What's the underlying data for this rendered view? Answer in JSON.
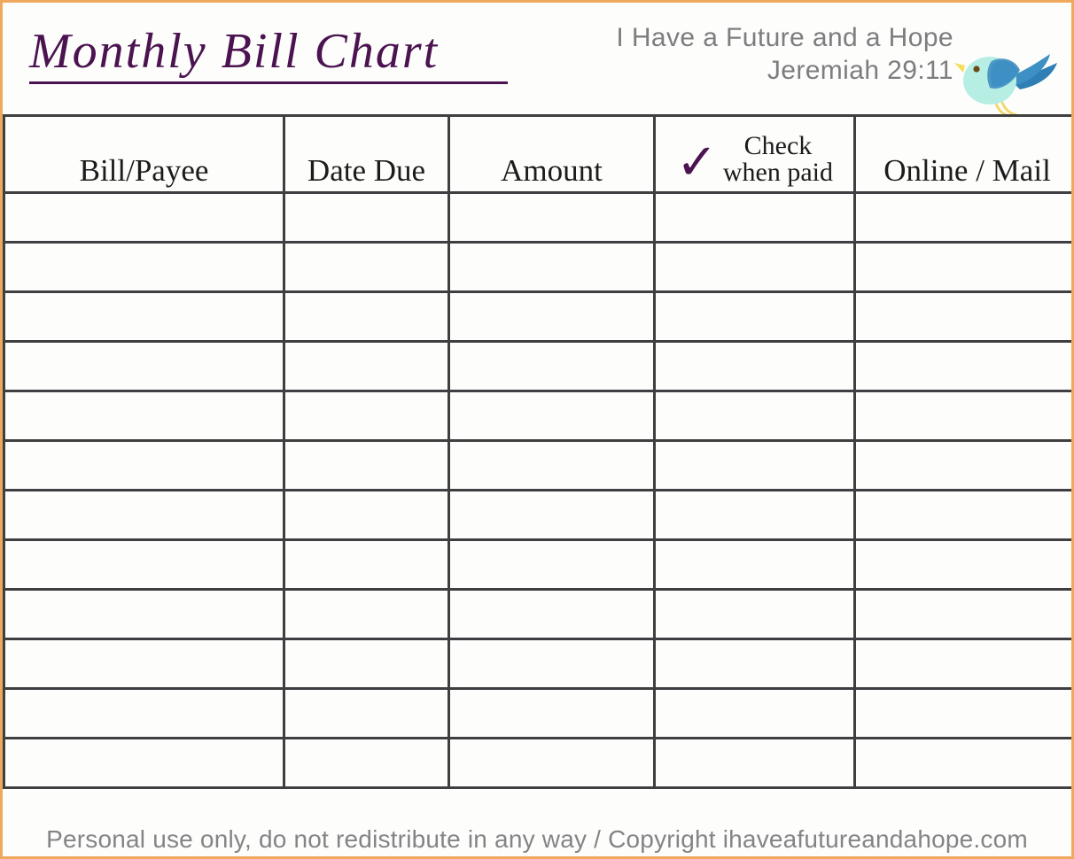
{
  "page": {
    "title": "Monthly Bill Chart",
    "accent_purple": "#4b1350",
    "border_orange": "#f0a95c",
    "grid_color": "#3f3f41",
    "muted_text": "#7d7d80"
  },
  "scripture": {
    "line1": "I Have a Future and a Hope",
    "line2": "Jeremiah 29:11"
  },
  "bird": {
    "icon_name": "bluebird-icon",
    "body_color": "#b6eee4",
    "wing_color": "#3e8fc3",
    "wing_shadow_color": "#2f7fb4",
    "beak_color": "#f7dd5c",
    "leg_color": "#f2d86a",
    "eye_color": "#6b4a16"
  },
  "table": {
    "columns": [
      {
        "key": "bill",
        "label": "Bill/Payee"
      },
      {
        "key": "date",
        "label": "Date Due"
      },
      {
        "key": "amount",
        "label": "Amount"
      },
      {
        "key": "check",
        "label_line1": "Check",
        "label_line2": "when paid",
        "mark": "✓"
      },
      {
        "key": "online",
        "label": "Online / Mail"
      }
    ],
    "row_count": 12,
    "rows": [
      {
        "bill": "",
        "date": "",
        "amount": "",
        "check": "",
        "online": ""
      },
      {
        "bill": "",
        "date": "",
        "amount": "",
        "check": "",
        "online": ""
      },
      {
        "bill": "",
        "date": "",
        "amount": "",
        "check": "",
        "online": ""
      },
      {
        "bill": "",
        "date": "",
        "amount": "",
        "check": "",
        "online": ""
      },
      {
        "bill": "",
        "date": "",
        "amount": "",
        "check": "",
        "online": ""
      },
      {
        "bill": "",
        "date": "",
        "amount": "",
        "check": "",
        "online": ""
      },
      {
        "bill": "",
        "date": "",
        "amount": "",
        "check": "",
        "online": ""
      },
      {
        "bill": "",
        "date": "",
        "amount": "",
        "check": "",
        "online": ""
      },
      {
        "bill": "",
        "date": "",
        "amount": "",
        "check": "",
        "online": ""
      },
      {
        "bill": "",
        "date": "",
        "amount": "",
        "check": "",
        "online": ""
      },
      {
        "bill": "",
        "date": "",
        "amount": "",
        "check": "",
        "online": ""
      },
      {
        "bill": "",
        "date": "",
        "amount": "",
        "check": "",
        "online": ""
      }
    ]
  },
  "footer": {
    "text": "Personal use only, do not redistribute in any way / Copyright ihaveafutureandahope.com"
  }
}
